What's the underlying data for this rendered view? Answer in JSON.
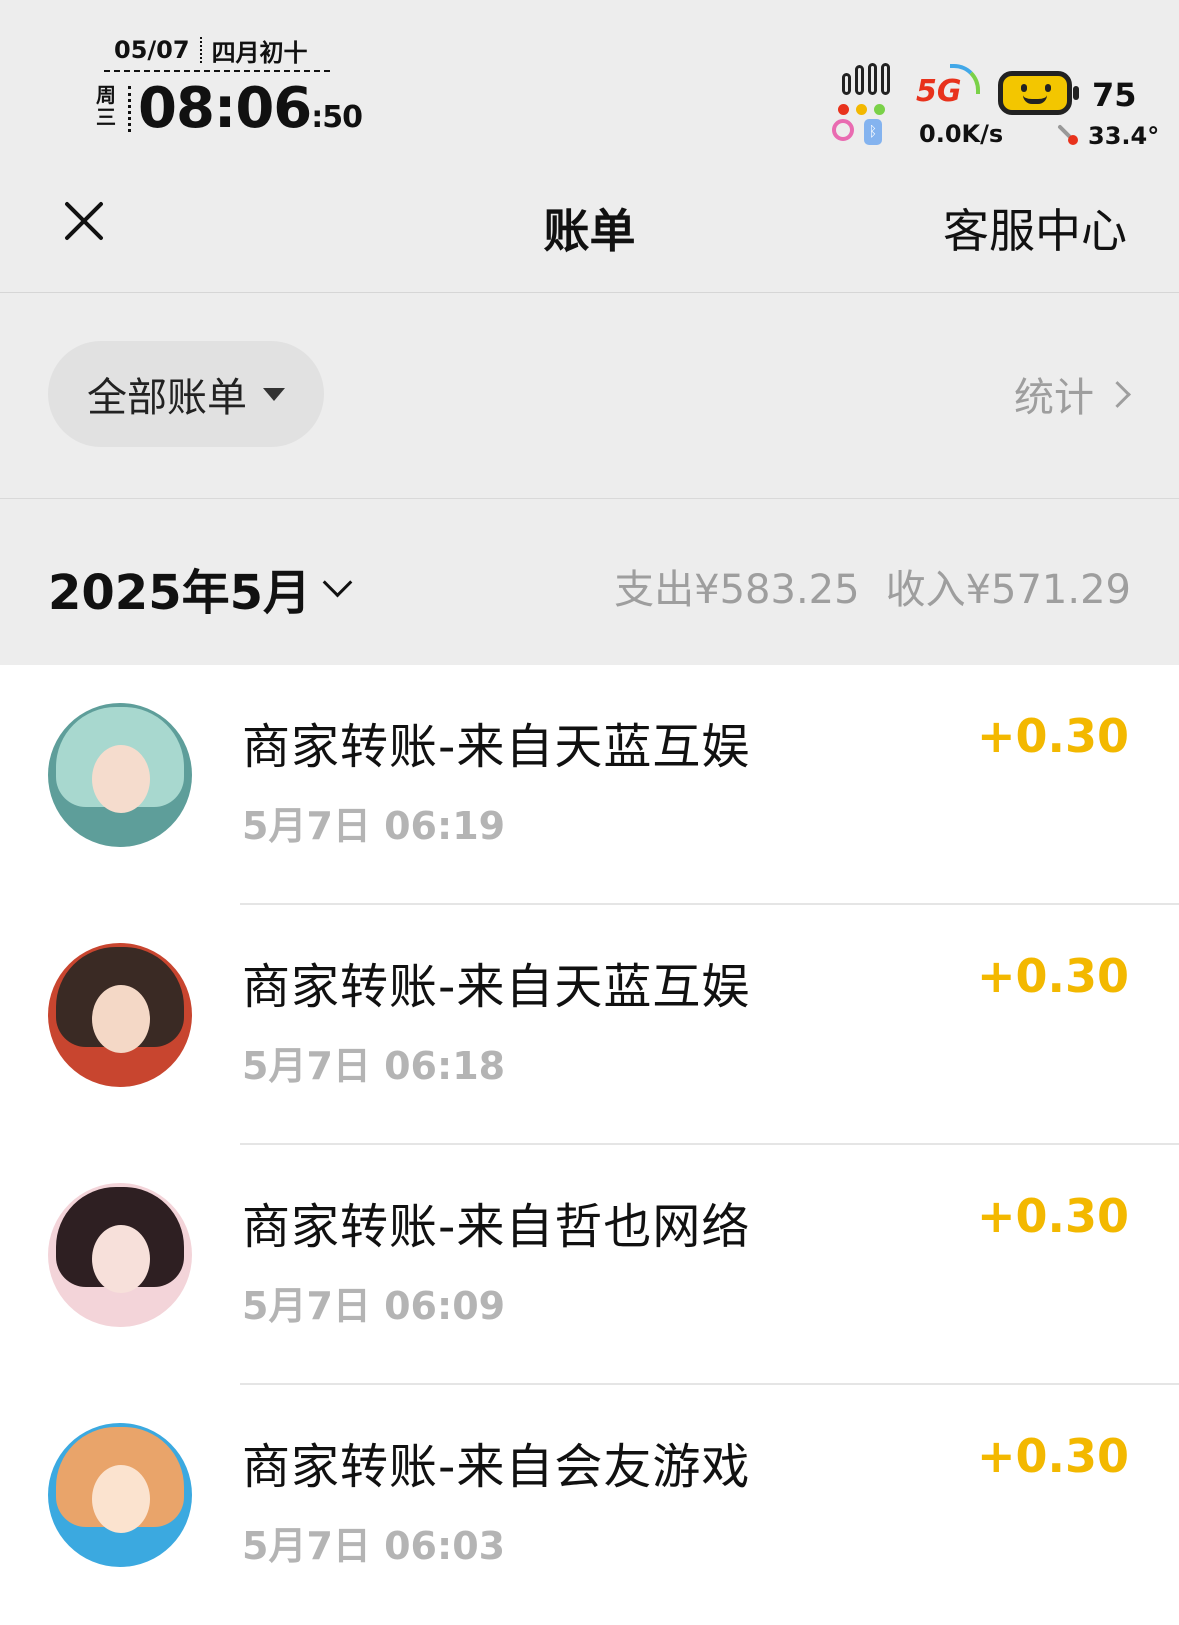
{
  "status_bar": {
    "date": "05/07",
    "lunar_date": "四月初十",
    "weekday": "周三",
    "time": "08:06",
    "seconds": ":50",
    "network_type": "5G",
    "net_speed": "0.0K/s",
    "battery_level": "75",
    "temperature": "33.4°"
  },
  "nav": {
    "title": "账单",
    "service_center": "客服中心"
  },
  "filter": {
    "all_bills": "全部账单",
    "statistics": "统计"
  },
  "month": {
    "label": "2025年5月",
    "expense": "支出¥583.25",
    "income": "收入¥571.29"
  },
  "transactions": [
    {
      "title": "商家转账-来自天蓝互娱",
      "time": "5月7日 06:19",
      "amount": "+0.30"
    },
    {
      "title": "商家转账-来自天蓝互娱",
      "time": "5月7日 06:18",
      "amount": "+0.30"
    },
    {
      "title": "商家转账-来自哲也网络",
      "time": "5月7日 06:09",
      "amount": "+0.30"
    },
    {
      "title": "商家转账-来自会友游戏",
      "time": "5月7日 06:03",
      "amount": "+0.30"
    }
  ],
  "colors": {
    "amount": "#f3b800",
    "background": "#ededed",
    "muted_text": "#9e9e9e"
  }
}
